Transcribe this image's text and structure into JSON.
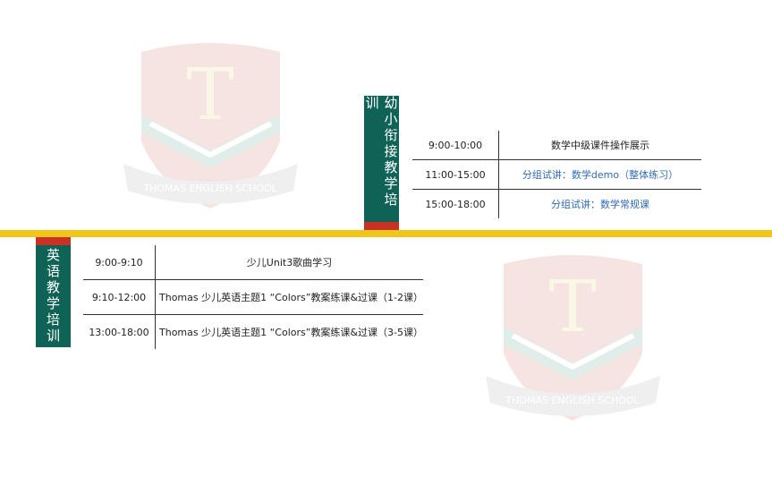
{
  "watermark": {
    "letter": "T",
    "text": "THOMAS ENGLISH SCHOOL"
  },
  "colors": {
    "tab_green": "#0f6356",
    "tab_red": "#c83224",
    "band_yellow": "#f0c61c",
    "link_blue": "#2f6bb3"
  },
  "section_math": {
    "title": "幼小衔接教学培训",
    "rows": [
      {
        "time": "9:00-10:00",
        "topic": "数学中级课件操作展示"
      },
      {
        "time": "11:00-15:00",
        "topic": "分组试讲：数学demo（整体练习）"
      },
      {
        "time": "15:00-18:00",
        "topic": "分组试讲：数学常规课"
      }
    ]
  },
  "section_english": {
    "title": "英语教学培训",
    "rows": [
      {
        "time": "9:00-9:10",
        "topic": "少儿Unit3歌曲学习"
      },
      {
        "time": "9:10-12:00",
        "topic": "Thomas 少儿英语主题1 “Colors”教案练课&过课（1-2课）"
      },
      {
        "time": "13:00-18:00",
        "topic": "Thomas 少儿英语主题1 “Colors”教案练课&过课（3-5课）"
      }
    ]
  }
}
